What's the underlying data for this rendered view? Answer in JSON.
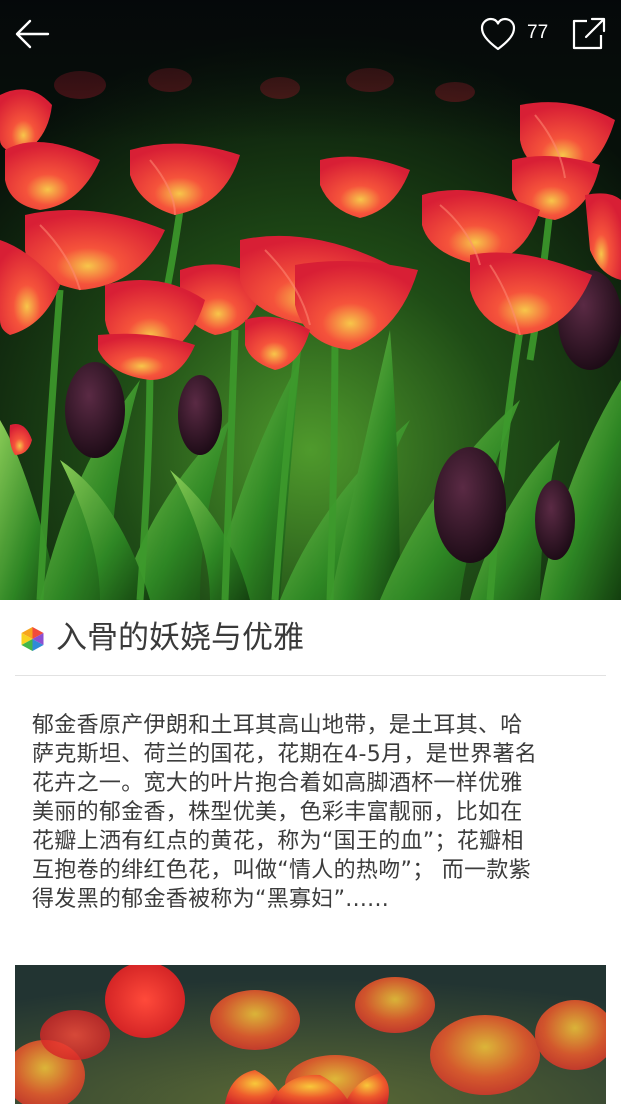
{
  "topbar": {
    "back_icon": "arrow-left-icon",
    "like_icon": "heart-outline-icon",
    "like_count": "77",
    "share_icon": "share-out-icon"
  },
  "article": {
    "logo_icon": "app-logo-icon",
    "title": "入骨的妖娆与优雅",
    "description_lines": [
      "郁金香原产伊朗和土耳其高山地带，是土耳其、哈",
      "萨克斯坦、荷兰的国花，花期在4-5月，是世界著名",
      "花卉之一。宽大的叶片抱合着如高脚酒杯一样优雅",
      "美丽的郁金香，株型优美，色彩丰富靓丽，比如在",
      "花瓣上洒有红点的黄花，称为“国王的血”；花瓣相",
      "互抱卷的绯红色花，叫做“情人的热吻”； 而一款紫",
      "得发黑的郁金香被称为“黑寡妇”......"
    ]
  },
  "colors": {
    "title_text": "#3a3a3a",
    "body_text": "#3c3c3c",
    "divider": "#e2e2e2",
    "tulip_red": "#f03a45",
    "tulip_yellow": "#f2c33a",
    "leaf_green": "#2f8a25",
    "dark_tulip": "#2a1422"
  }
}
